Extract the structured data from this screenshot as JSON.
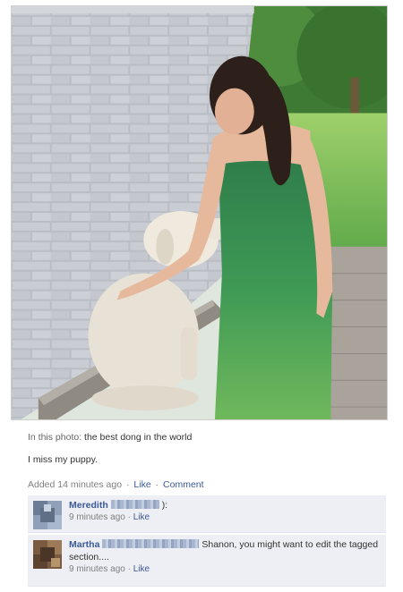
{
  "photo": {
    "subject_icon": "dog-and-woman-photo"
  },
  "caption": {
    "prefix": "In this photo:",
    "tagged_text": "the best dong in the world"
  },
  "status": {
    "text": "I miss my puppy."
  },
  "post_meta": {
    "added": "Added 14 minutes ago",
    "sep1": "·",
    "like_label": "Like",
    "sep2": "·",
    "comment_label": "Comment"
  },
  "comments": [
    {
      "author": "Meredith",
      "text": "):",
      "time": "9 minutes ago",
      "sep": "·",
      "like_label": "Like",
      "avatar_icon": "user-avatar-icon"
    },
    {
      "author": "Martha",
      "text": "Shanon, you might want to edit the tagged section....",
      "time": "9 minutes ago",
      "sep": "·",
      "like_label": "Like",
      "avatar_icon": "user-avatar-icon"
    }
  ],
  "colors": {
    "link": "#3b5998",
    "comment_bg": "#edeff4",
    "muted": "#808080"
  }
}
